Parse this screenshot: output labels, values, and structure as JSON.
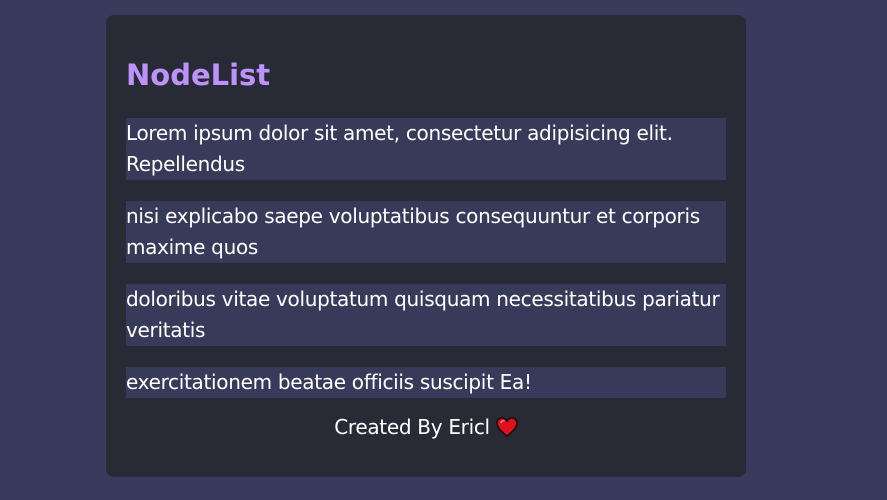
{
  "card": {
    "title": "NodeList",
    "items": [
      "Lorem ipsum dolor sit amet, consectetur adipisicing elit. Repellendus",
      "nisi explicabo saepe voluptatibus consequuntur et corporis maxime quos",
      "doloribus vitae voluptatum quisquam necessitatibus pariatur veritatis",
      "exercitationem beatae officiis suscipit Ea!"
    ],
    "footer": {
      "text": "Created By Ericl",
      "icon": "heart-icon"
    }
  },
  "colors": {
    "page_background": "#3a3a5c",
    "card_background": "#282a36",
    "title": "#bd93f9",
    "item_background": "#383a59",
    "heart": "#e01020"
  }
}
